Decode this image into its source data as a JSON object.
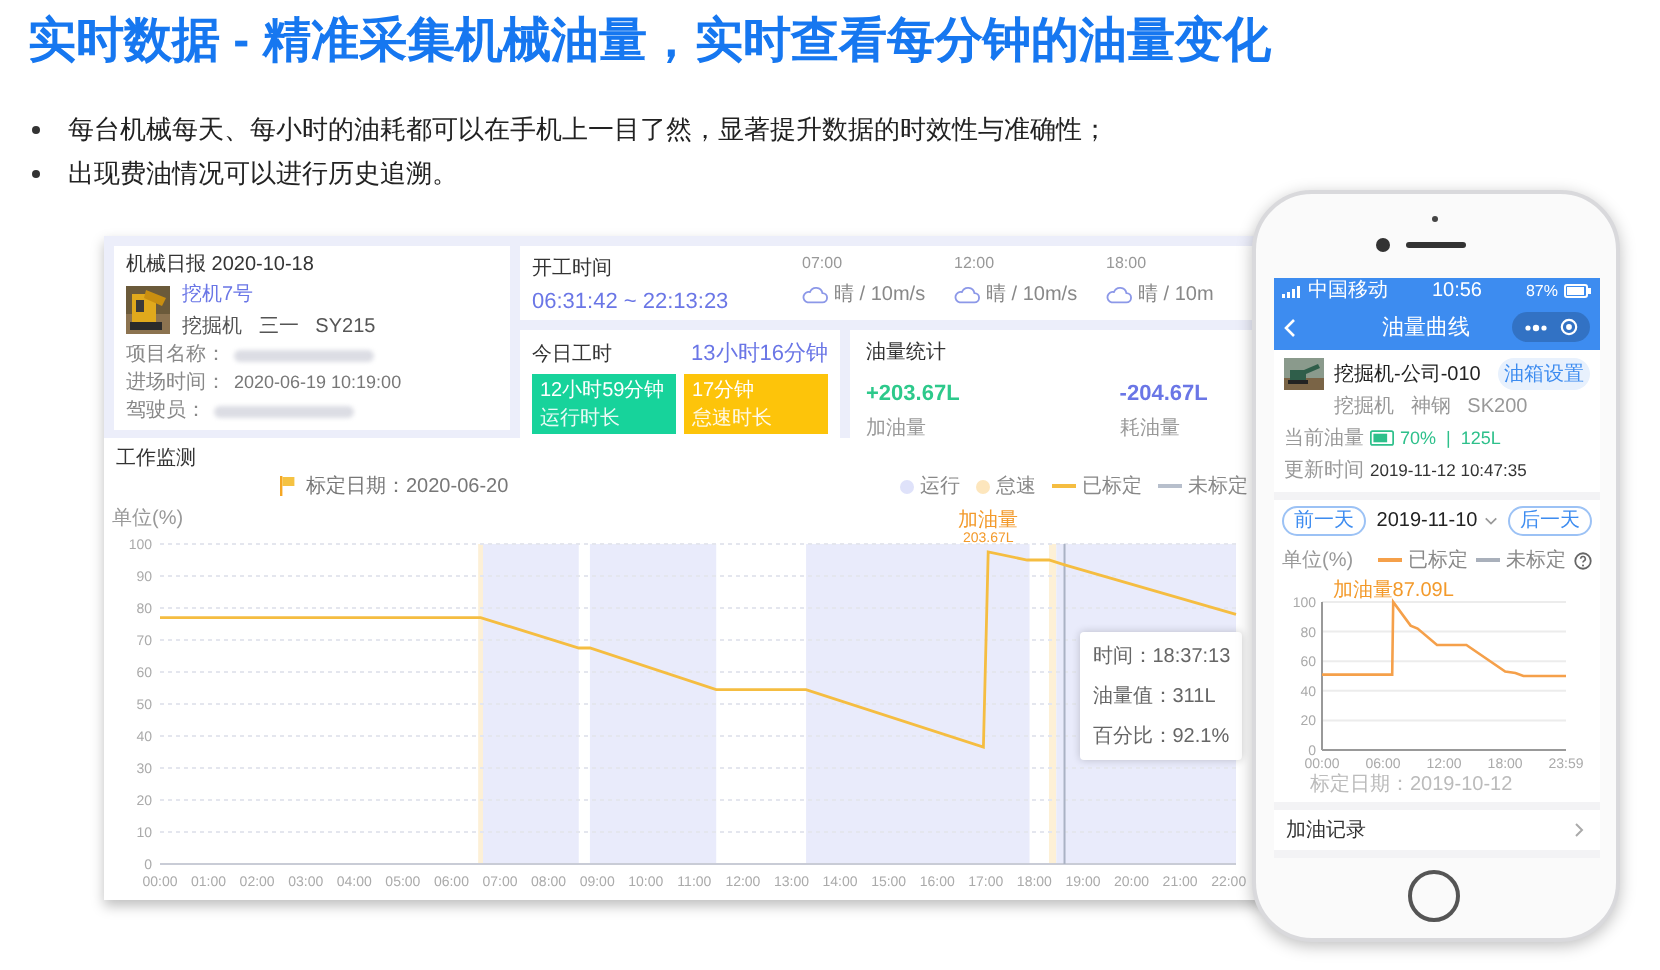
{
  "headline": "实时数据 - 精准采集机械油量，实时查看每分钟的油量变化",
  "bullets": [
    "每台机械每天、每小时的油耗都可以在手机上一目了然，显著提升数据的时效性与准确性；",
    "出现费油情况可以进行历史追溯。"
  ],
  "dashboard": {
    "report": {
      "title": "机械日报 2020-10-18",
      "machine_name": "挖机7号",
      "machine_specs": "挖掘机   三一   SY215",
      "fields": [
        {
          "kind": "redacted",
          "label": "项目名称："
        },
        {
          "kind": "text",
          "label": "进场时间：",
          "value": "2020-06-19 10:19:00"
        },
        {
          "kind": "redacted",
          "label": "驾驶员："
        }
      ]
    },
    "work_time": {
      "title": "开工时间",
      "range": "06:31:42 ~ 22:13:23",
      "weather": [
        {
          "time": "07:00",
          "condition": "晴 / 10m/s"
        },
        {
          "time": "12:00",
          "condition": "晴 / 10m/s"
        },
        {
          "time": "18:00",
          "condition": "晴 / 10m"
        }
      ]
    },
    "hours": {
      "title": "今日工时",
      "total": "13小时16分钟",
      "tiles": [
        {
          "kind": "run",
          "value": "12小时59分钟",
          "label": "运行时长"
        },
        {
          "kind": "idle",
          "value": "17分钟",
          "label": "怠速时长"
        }
      ]
    },
    "oil": {
      "title": "油量统计",
      "stats": [
        {
          "kind": "add",
          "value": "+203.67L",
          "label": "加油量"
        },
        {
          "kind": "use",
          "value": "-204.67L",
          "label": "耗油量"
        }
      ]
    },
    "monitor": {
      "title": "工作监测",
      "calibration": "标定日期：2020-06-20",
      "legend": [
        {
          "kind": "dot",
          "label": "运行",
          "color": "#dfe2fa"
        },
        {
          "kind": "dot",
          "label": "怠速",
          "color": "#fde6bd"
        },
        {
          "kind": "series"
        },
        {
          "kind": "line",
          "label": "未标定",
          "color": "#b7bfcc"
        }
      ],
      "tooltip": [
        "时间：18:37:13",
        "油量值：311L",
        "百分比：92.1%"
      ],
      "chart_data": {
        "type": "line",
        "ylabel": "单位(%)",
        "x": [
          0,
          6.6,
          8.62,
          8.85,
          11.45,
          13.3,
          16.95,
          17.05,
          17.85,
          18.3,
          18.62,
          22.15
        ],
        "series": [
          {
            "name": "已标定",
            "color": "#f5bd41",
            "values": [
              77,
              77,
              67.5,
              67.5,
              54.5,
              54.5,
              36.5,
              97.5,
              95,
              95,
              93.5,
              78
            ]
          }
        ],
        "xlim": [
          0,
          22.15
        ],
        "ylim": [
          0,
          100
        ],
        "grid": true,
        "xticks": [
          {
            "value": 0,
            "label": "00:00"
          },
          {
            "value": 1,
            "label": "01:00"
          },
          {
            "value": 2,
            "label": "02:00"
          },
          {
            "value": 3,
            "label": "03:00"
          },
          {
            "value": 4,
            "label": "04:00"
          },
          {
            "value": 5,
            "label": "05:00"
          },
          {
            "value": 6,
            "label": "06:00"
          },
          {
            "value": 7,
            "label": "07:00"
          },
          {
            "value": 8,
            "label": "08:00"
          },
          {
            "value": 9,
            "label": "09:00"
          },
          {
            "value": 10,
            "label": "10:00"
          },
          {
            "value": 11,
            "label": "11:00"
          },
          {
            "value": 12,
            "label": "12:00"
          },
          {
            "value": 13,
            "label": "13:00"
          },
          {
            "value": 14,
            "label": "14:00"
          },
          {
            "value": 15,
            "label": "15:00"
          },
          {
            "value": 16,
            "label": "16:00"
          },
          {
            "value": 17,
            "label": "17:00"
          },
          {
            "value": 18,
            "label": "18:00"
          },
          {
            "value": 19,
            "label": "19:00"
          },
          {
            "value": 20,
            "label": "20:00"
          },
          {
            "value": 21,
            "label": "21:00"
          },
          {
            "value": 22,
            "label": "22:00"
          }
        ],
        "yticks": [
          0,
          10,
          20,
          30,
          40,
          50,
          60,
          70,
          80,
          90,
          100
        ],
        "bands": [
          {
            "axis": "x",
            "from": 6.55,
            "to": 6.65,
            "color": "#fdf0d6"
          },
          {
            "axis": "x",
            "from": 6.65,
            "to": 8.62,
            "color": "#e9ebfb"
          },
          {
            "axis": "x",
            "from": 8.85,
            "to": 11.45,
            "color": "#e9ebfb"
          },
          {
            "axis": "x",
            "from": 13.3,
            "to": 17.9,
            "color": "#e9ebfb"
          },
          {
            "axis": "x",
            "from": 18.3,
            "to": 18.45,
            "color": "#fdf0d6"
          },
          {
            "axis": "x",
            "from": 18.45,
            "to": 22.15,
            "color": "#e9ebfb"
          }
        ],
        "ref_lines": [
          {
            "axis": "x",
            "value": 18.62,
            "color": "#aab2c4"
          }
        ],
        "annotations": [
          {
            "text": "加油量"
          },
          {
            "text": "203.67L"
          }
        ]
      }
    }
  },
  "phone": {
    "status": {
      "carrier": "中国移动",
      "time": "10:56",
      "battery": "87%"
    },
    "nav_title": "油量曲线",
    "machine": {
      "name": "挖掘机-公司-010",
      "specs": "挖掘机   神钢   SK200",
      "action": "油箱设置",
      "fuel_label": "当前油量",
      "fuel": "70%  |  125L",
      "updated_label": "更新时间",
      "updated": "2019-11-12 10:47:35"
    },
    "date_nav": {
      "prev": "前一天",
      "date": "2019-11-10",
      "next": "后一天"
    },
    "chart": {
      "legend": [
        {
          "kind": "series"
        },
        {
          "kind": "line",
          "label": "未标定",
          "color": "#a9b0bb"
        }
      ],
      "chart_data": {
        "type": "line",
        "ylabel": "单位(%)",
        "x": [
          0,
          6.9,
          7,
          8.7,
          9.4,
          11.3,
          14.2,
          18,
          19,
          19.8,
          23.983
        ],
        "series": [
          {
            "name": "已标定",
            "color": "#f5a04a",
            "values": [
              51,
              51,
              100,
              84,
              82,
              71,
              71,
              53,
              52,
              50,
              50
            ]
          }
        ],
        "xlim": [
          0,
          23.983
        ],
        "ylim": [
          0,
          100
        ],
        "grid": true,
        "xticks": [
          {
            "value": 0,
            "label": "00:00"
          },
          {
            "value": 6,
            "label": "06:00"
          },
          {
            "value": 12,
            "label": "12:00"
          },
          {
            "value": 18,
            "label": "18:00"
          },
          {
            "value": 23.983,
            "label": "23:59"
          }
        ],
        "yticks": [
          0,
          20,
          40,
          60,
          80,
          100
        ],
        "annotations": [
          {
            "text": "加油量87.09L"
          }
        ]
      },
      "calibration": "标定日期：2019-10-12"
    },
    "refuel_row": "加油记录"
  }
}
